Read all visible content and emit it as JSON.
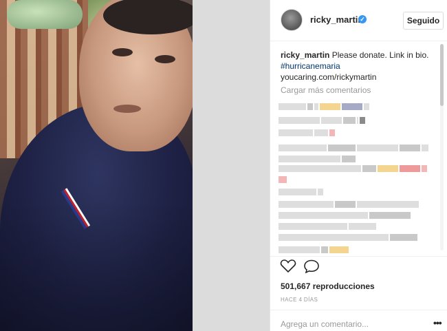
{
  "post": {
    "username": "ricky_martin",
    "verified_glyph": "✓",
    "follow_label": "Seguido",
    "caption_user": "ricky_martin",
    "caption_text": "Please donate. Link in bio.",
    "hashtag": "#hurricanemaria",
    "link": "youcaring.com/rickymartin",
    "load_more": "Cargar más comentarios",
    "views": "501,667 reproducciones",
    "timestamp": "HACE 4 DÍAS",
    "comment_placeholder": "Agrega un comentario...",
    "more_glyph": "•••"
  },
  "icons": {
    "like": "heart-icon",
    "comment": "comment-bubble-icon",
    "verified": "verified-badge-icon",
    "more": "more-options-icon"
  },
  "colors": {
    "accent": "#3897f0",
    "hashtag": "#003569",
    "muted": "#999999",
    "text": "#262626"
  }
}
